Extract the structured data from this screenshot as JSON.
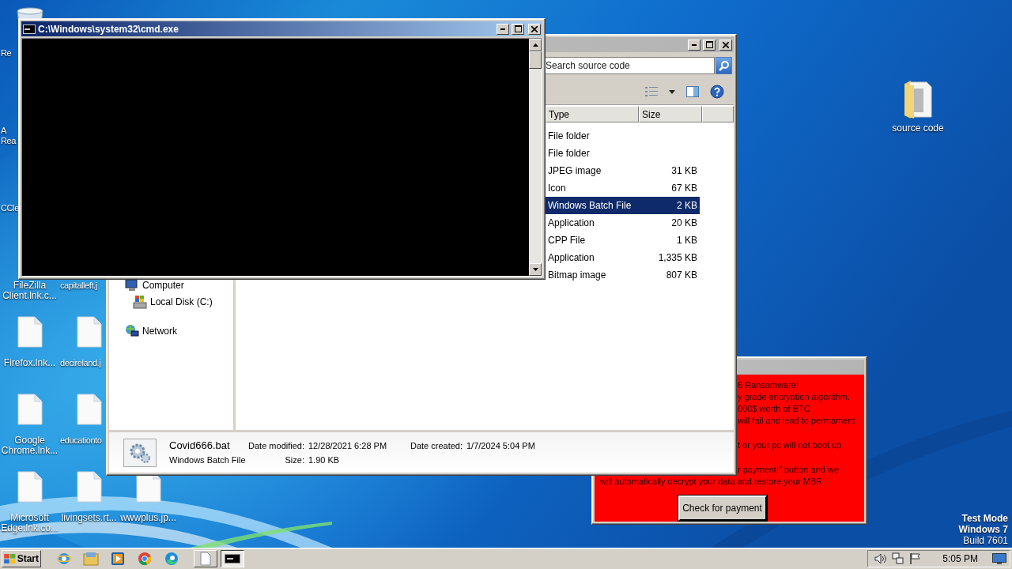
{
  "desktop": {
    "columns": [
      [
        {
          "kind": "recycle-bin",
          "label": [
            "Re"
          ],
          "cut": true
        },
        {
          "label": [
            "A",
            "Rea"
          ],
          "cut": true
        },
        {
          "label": [
            "CCle"
          ],
          "cut": true
        },
        {
          "label": [
            "FileZilla",
            "Client.lnk.c..."
          ]
        },
        {
          "kind": "file",
          "label": [
            "Firefox.lnk..."
          ]
        },
        {
          "kind": "file",
          "label": [
            "Google",
            "Chrome.lnk..."
          ]
        },
        {
          "kind": "file",
          "label": [
            "Microsoft",
            "Edge.lnk.co..."
          ]
        }
      ],
      [
        null,
        null,
        null,
        {
          "label": [
            "capitalleft.j"
          ],
          "cut": true
        },
        {
          "kind": "file",
          "label": [
            "decireland.j"
          ],
          "cut": true
        },
        {
          "kind": "file",
          "label": [
            "educationto"
          ],
          "cut": true
        },
        {
          "kind": "file",
          "label": [
            "livingsets.rt..."
          ]
        }
      ],
      [
        null,
        null,
        null,
        null,
        null,
        null,
        {
          "kind": "file",
          "label": [
            "wwwplus.jp..."
          ]
        }
      ]
    ],
    "right_icon": {
      "kind": "folder",
      "label": "source code"
    },
    "notice": [
      {
        "text": "Test Mode",
        "kind": "heading"
      },
      {
        "text": "Windows 7",
        "kind": "heading"
      },
      {
        "text": "Build 7601",
        "kind": "plain"
      }
    ]
  },
  "ransom_window": {
    "paragraphs": [
      [
        {
          "text": "6 Ransomware!",
          "cut": true
        },
        {
          "text": "y grade encryption algorithm.",
          "cut": true
        },
        {
          "text": "000$ worth of BTC",
          "cut": true
        },
        {
          "text": "will fail and lead to permament",
          "cut": true
        }
      ],
      [
        {
          "text": "t or your pc will not boot up",
          "cut": true
        }
      ],
      [
        {
          "text": "r payment!\" button and we",
          "cut": true
        },
        {
          "text": "will automatically decrypt your data and restore your MBR",
          "cut": false
        }
      ]
    ],
    "button": "Check for payment"
  },
  "explorer": {
    "search": {
      "placeholder": "Search source code"
    },
    "columns": [
      "Type",
      "Size"
    ],
    "rows": [
      {
        "type": "File folder",
        "selected": false
      },
      {
        "type": "File folder",
        "selected": false
      },
      {
        "type": "JPEG image",
        "size": "31 KB",
        "selected": false
      },
      {
        "type": "Icon",
        "size": "67 KB",
        "selected": false
      },
      {
        "type": "Windows Batch File",
        "size": "2 KB",
        "selected": true
      },
      {
        "type": "Application",
        "size": "20 KB",
        "selected": false
      },
      {
        "type": "CPP File",
        "size": "1 KB",
        "selected": false
      },
      {
        "type": "Application",
        "size": "1,335 KB",
        "selected": false
      },
      {
        "type": "Bitmap image",
        "size": "807 KB",
        "selected": false
      }
    ],
    "nav": [
      {
        "kind": "computer",
        "label": "Computer",
        "children": [
          {
            "kind": "disk",
            "label": "Local Disk (C:)"
          }
        ]
      },
      {
        "kind": "network",
        "label": "Network"
      }
    ],
    "details": {
      "name": "Covid666.bat",
      "type": "Windows Batch File",
      "fields": [
        {
          "label": "Date modified:",
          "value": "12/28/2021 6:28 PM"
        },
        {
          "label": "Size:",
          "value": "1.90 KB"
        },
        {
          "label": "Date created:",
          "value": "1/7/2024 5:04 PM"
        }
      ]
    }
  },
  "cmd": {
    "title": "C:\\Windows\\system32\\cmd.exe"
  },
  "taskbar": {
    "start": "Start",
    "pinned": [
      {
        "kind": "ie"
      },
      {
        "kind": "explorer"
      },
      {
        "kind": "media"
      },
      {
        "kind": "chrome"
      },
      {
        "kind": "edge"
      }
    ],
    "tasks": [
      {
        "kind": "document",
        "selected": false
      },
      {
        "kind": "cmd",
        "selected": true
      }
    ],
    "tray": [
      {
        "kind": "speaker"
      },
      {
        "kind": "network"
      },
      {
        "kind": "flag"
      }
    ],
    "clock": "5:05 PM"
  }
}
